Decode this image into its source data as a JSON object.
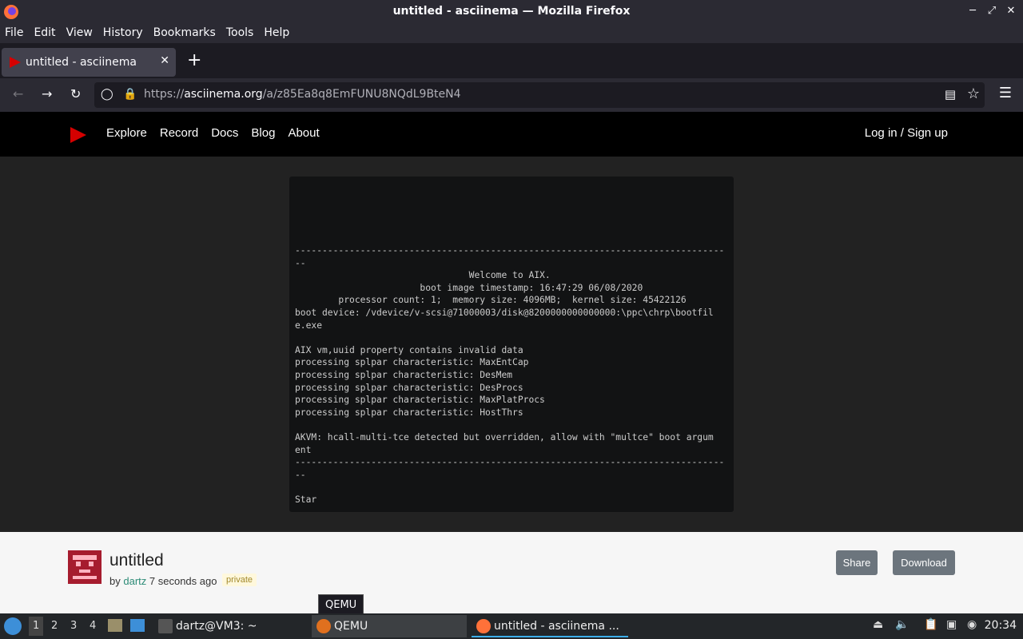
{
  "window": {
    "title": "untitled - asciinema — Mozilla Firefox"
  },
  "menubar": [
    "File",
    "Edit",
    "View",
    "History",
    "Bookmarks",
    "Tools",
    "Help"
  ],
  "tab": {
    "title": "untitled - asciinema"
  },
  "urlbar": {
    "prefix": "https://",
    "domain": "asciinema.org",
    "path": "/a/z85Ea8q8EmFUNU8NQdL9BteN4"
  },
  "site": {
    "nav": [
      "Explore",
      "Record",
      "Docs",
      "Blog",
      "About"
    ],
    "login": "Log in / Sign up"
  },
  "terminal": {
    "lines": [
      "-------------------------------------------------------------------------------",
      "--",
      "                                Welcome to AIX.",
      "                       boot image timestamp: 16:47:29 06/08/2020",
      "        processor count: 1;  memory size: 4096MB;  kernel size: 45422126",
      "boot device: /vdevice/v-scsi@71000003/disk@8200000000000000:\\ppc\\chrp\\bootfil",
      "e.exe",
      "",
      "AIX vm,uuid property contains invalid data",
      "processing splpar characteristic: MaxEntCap",
      "processing splpar characteristic: DesMem",
      "processing splpar characteristic: DesProcs",
      "processing splpar characteristic: MaxPlatProcs",
      "processing splpar characteristic: HostThrs",
      "",
      "AKVM: hcall-multi-tce detected but overridden, allow with \"multce\" boot argum",
      "ent",
      "-------------------------------------------------------------------------------",
      "--",
      "",
      "Star"
    ]
  },
  "recording": {
    "title": "untitled",
    "by": "by",
    "author": "dartz",
    "time": "7 seconds ago",
    "badge": "private",
    "share": "Share",
    "download": "Download"
  },
  "tooltip": "QEMU",
  "taskbar": {
    "workspaces": [
      "1",
      "2",
      "3",
      "4"
    ],
    "tasks": {
      "terminal": "dartz@VM3: ~",
      "qemu": "QEMU",
      "firefox": "untitled - asciinema ..."
    },
    "clock": "20:34"
  }
}
